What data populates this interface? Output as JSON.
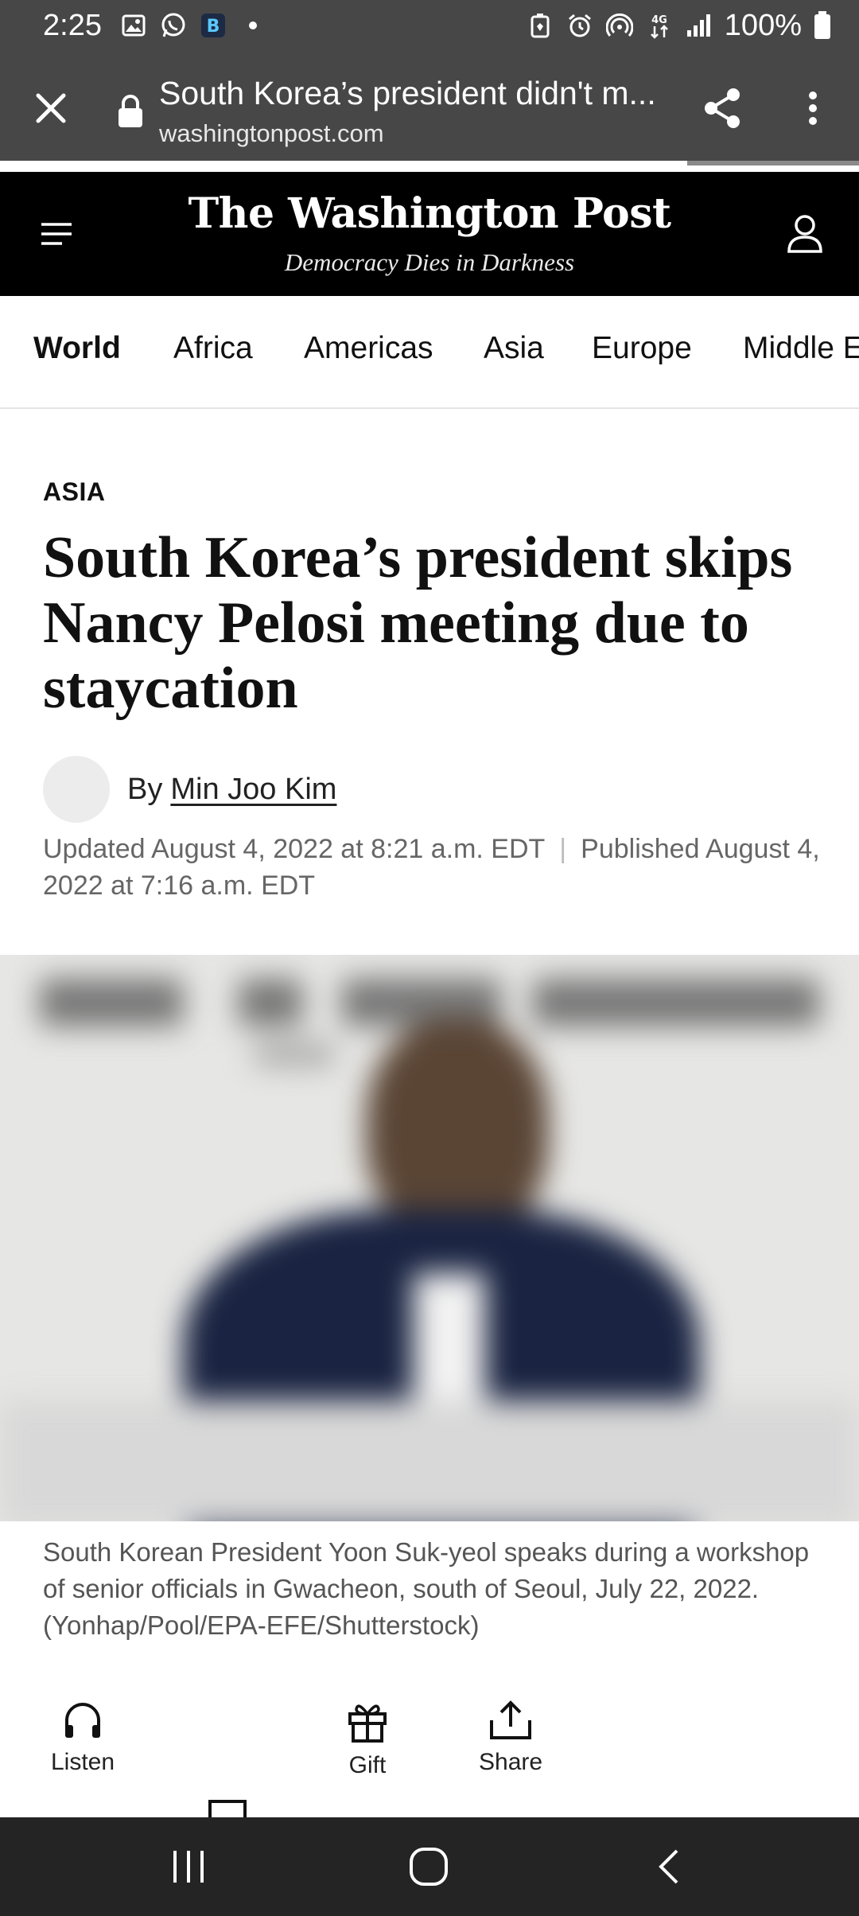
{
  "status_bar": {
    "time": "2:25",
    "battery": "100%",
    "network": "4G"
  },
  "browser": {
    "title": "South Korea’s president didn't m...",
    "url": "washingtonpost.com",
    "load_progress": 0.8
  },
  "masthead": {
    "name": "The Washington Post",
    "tagline": "Democracy Dies in Darkness"
  },
  "section_nav": {
    "items": [
      {
        "label": "World",
        "active": true
      },
      {
        "label": "Africa",
        "active": false
      },
      {
        "label": "Americas",
        "active": false
      },
      {
        "label": "Asia",
        "active": false
      },
      {
        "label": "Europe",
        "active": false
      },
      {
        "label": "Middle East",
        "active": false
      }
    ]
  },
  "article": {
    "kicker": "ASIA",
    "headline": "South Korea’s president skips Nancy Pelosi meeting due to staycation",
    "byline_prefix": "By",
    "author": "Min Joo Kim",
    "updated": "Updated August 4, 2022 at 8:21 a.m. EDT",
    "separator": "|",
    "published": "Published August 4, 2022 at 7:16 a.m. EDT",
    "caption": "South Korean President Yoon Suk-yeol speaks during a workshop of senior officials in Gwacheon, south of Seoul, July 22, 2022. (Yonhap/Pool/EPA-EFE/Shutterstock)"
  },
  "actions": {
    "listen": "Listen",
    "gift": "Gift",
    "share": "Share"
  },
  "colors": {
    "browser_bar": "#474747",
    "header_bg": "#000000",
    "nav_bar": "#242424"
  }
}
